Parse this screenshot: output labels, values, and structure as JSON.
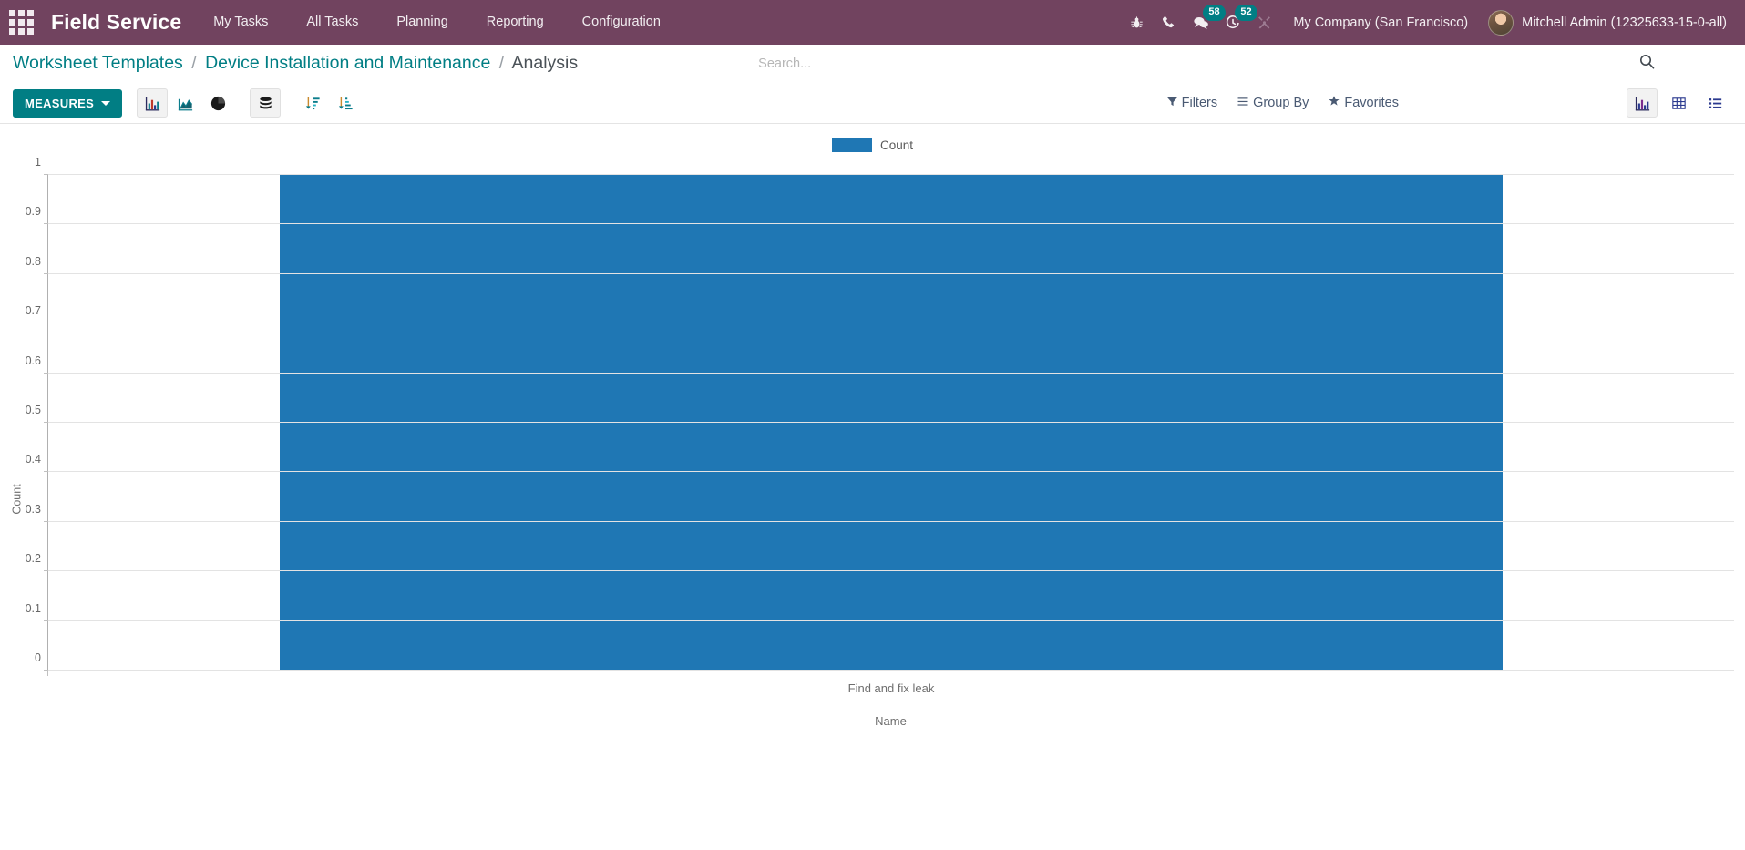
{
  "navbar": {
    "apps_icon": "apps-grid-icon",
    "brand": "Field Service",
    "menu": [
      {
        "label": "My Tasks"
      },
      {
        "label": "All Tasks"
      },
      {
        "label": "Planning"
      },
      {
        "label": "Reporting"
      },
      {
        "label": "Configuration"
      }
    ],
    "icons": [
      {
        "name": "bug-icon",
        "badge": ""
      },
      {
        "name": "phone-icon",
        "badge": ""
      },
      {
        "name": "messages-icon",
        "badge": "58"
      },
      {
        "name": "activities-clock-icon",
        "badge": "52"
      },
      {
        "name": "tools-wrench-icon",
        "badge": ""
      }
    ],
    "messages_badge": "58",
    "activities_badge": "52",
    "company": "My Company (San Francisco)",
    "user": "Mitchell Admin (12325633-15-0-all)",
    "bg_color": "#71435f",
    "badge_color": "#017e84"
  },
  "breadcrumb": {
    "items": [
      {
        "label": "Worksheet Templates",
        "active": false
      },
      {
        "label": "Device Installation and Maintenance",
        "active": false
      },
      {
        "label": "Analysis",
        "active": true
      }
    ],
    "separator": "/"
  },
  "search": {
    "value": "",
    "placeholder": "Search...",
    "icon": "search-icon"
  },
  "toolbar": {
    "measures_label": "MEASURES",
    "chart_buttons": [
      {
        "name": "bar-chart-icon",
        "active": true
      },
      {
        "name": "line-chart-icon",
        "active": false
      },
      {
        "name": "pie-chart-icon",
        "active": false
      }
    ],
    "stack_button": {
      "name": "stacked-database-icon",
      "active": true
    },
    "sort_buttons": [
      {
        "name": "sort-descending-icon",
        "active": false
      },
      {
        "name": "sort-ascending-icon",
        "active": false
      }
    ],
    "filters": [
      {
        "label": "Filters",
        "icon": "filter-funnel-icon"
      },
      {
        "label": "Group By",
        "icon": "group-by-lines-icon"
      },
      {
        "label": "Favorites",
        "icon": "favorites-star-icon"
      }
    ],
    "views": [
      {
        "name": "graph-view-icon",
        "active": true
      },
      {
        "name": "pivot-view-icon",
        "active": false
      },
      {
        "name": "list-view-icon",
        "active": false
      }
    ],
    "accent_color": "#017e84"
  },
  "chart_data": {
    "type": "bar",
    "title": "",
    "categories": [
      "Find and fix leak"
    ],
    "values": [
      1
    ],
    "series": [
      {
        "name": "Count",
        "values": [
          1
        ],
        "color": "#1f77b4"
      }
    ],
    "xlabel": "Name",
    "ylabel": "Count",
    "ylim": [
      0,
      1
    ],
    "yticks": [
      "0",
      "0.1",
      "0.2",
      "0.3",
      "0.4",
      "0.5",
      "0.6",
      "0.7",
      "0.8",
      "0.9",
      "1"
    ],
    "grid": true,
    "legend": {
      "position": "top",
      "entries": [
        "Count"
      ]
    }
  }
}
